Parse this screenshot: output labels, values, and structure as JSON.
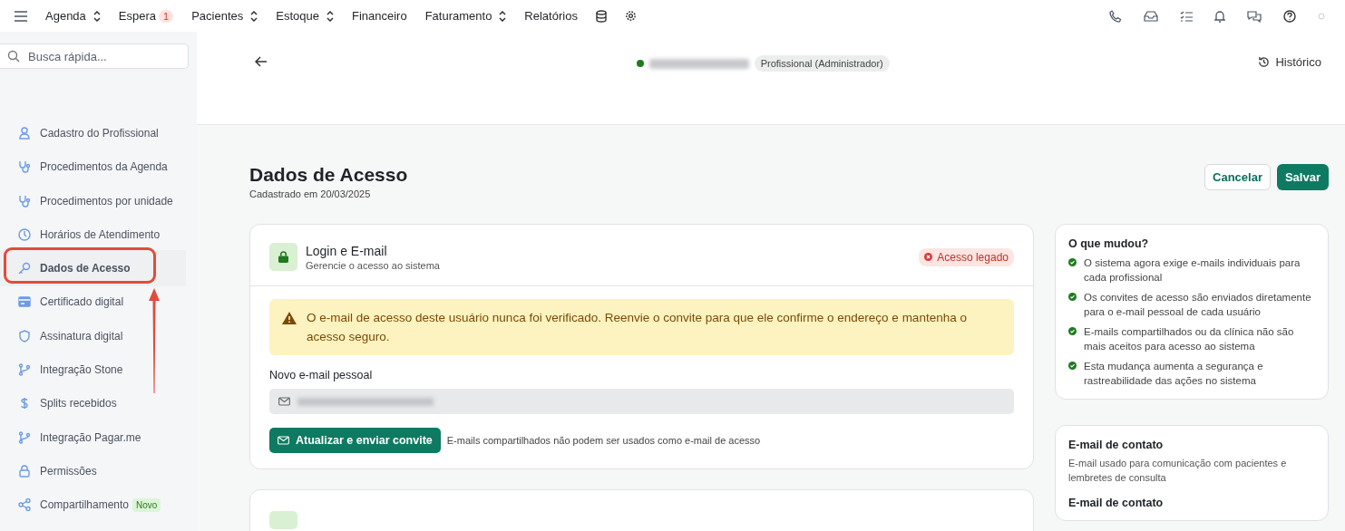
{
  "top_nav": {
    "items": [
      {
        "label": "Agenda",
        "dropdown": true
      },
      {
        "label": "Espera",
        "dropdown": false,
        "badge": "1"
      },
      {
        "label": "Pacientes",
        "dropdown": true
      },
      {
        "label": "Estoque",
        "dropdown": true
      },
      {
        "label": "Financeiro",
        "dropdown": false
      },
      {
        "label": "Faturamento",
        "dropdown": true
      },
      {
        "label": "Relatórios",
        "dropdown": false
      }
    ]
  },
  "sidebar": {
    "search": {
      "placeholder": "Busca rápida..."
    },
    "items": [
      {
        "label": "Cadastro do Profissional",
        "kind": "user",
        "selected": false
      },
      {
        "label": "Procedimentos da Agenda",
        "kind": "stethoscope",
        "selected": false
      },
      {
        "label": "Procedimentos por unidade",
        "kind": "stethoscope",
        "selected": false
      },
      {
        "label": "Horários de Atendimento",
        "kind": "clock",
        "selected": false
      },
      {
        "label": "Dados de Acesso",
        "kind": "key",
        "selected": true
      },
      {
        "label": "Certificado digital",
        "kind": "card",
        "selected": false
      },
      {
        "label": "Assinatura digital",
        "kind": "shield",
        "selected": false
      },
      {
        "label": "Integração Stone",
        "kind": "branch",
        "selected": false
      },
      {
        "label": "Splits recebidos",
        "kind": "dollar",
        "selected": false
      },
      {
        "label": "Integração Pagar.me",
        "kind": "branch",
        "selected": false
      },
      {
        "label": "Permissões",
        "kind": "lock",
        "selected": false
      },
      {
        "label": "Compartilhamento",
        "kind": "share",
        "selected": false,
        "badge": "Novo"
      }
    ]
  },
  "header": {
    "role": "Profissional (Administrador)",
    "history": "Histórico"
  },
  "page": {
    "title": "Dados de Acesso",
    "subtitle": "Cadastrado em 20/03/2025",
    "cancel": "Cancelar",
    "save": "Salvar"
  },
  "login_card": {
    "title": "Login e E-mail",
    "subtitle": "Gerencie o acesso ao sistema",
    "status": "Acesso legado",
    "warning": "O e-mail de acesso deste usuário nunca foi verificado. Reenvie o convite para que ele confirme o endereço e mantenha o acesso seguro.",
    "field_label": "Novo e-mail pessoal",
    "button": "Atualizar e enviar convite",
    "hint": "E-mails compartilhados não podem ser usados como e-mail de acesso"
  },
  "changes_card": {
    "title": "O que mudou?",
    "items": [
      "O sistema agora exige e-mails individuais para cada profissional",
      "Os convites de acesso são enviados diretamente para o e-mail pessoal de cada usuário",
      "E-mails compartilhados ou da clínica não são mais aceitos para acesso ao sistema",
      "Esta mudança aumenta a segurança e rastreabilidade das ações no sistema"
    ]
  },
  "contact_card": {
    "title": "E-mail de contato",
    "description": "E-mail usado para comunicação com pacientes e lembretes de consulta",
    "field_label": "E-mail de contato"
  }
}
